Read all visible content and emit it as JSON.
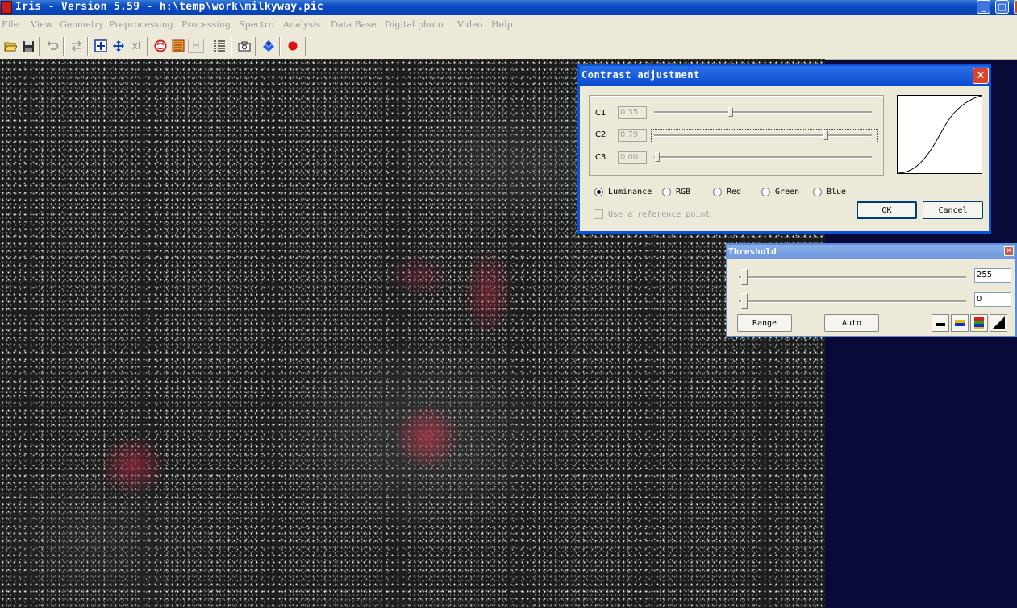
{
  "window": {
    "title": "Iris - Version 5.59 - h:\\temp\\work\\milkyway.pic"
  },
  "menu": [
    "File",
    "View",
    "Geometry",
    "Preprocessing",
    "Processing",
    "Spectro",
    "Analysis",
    "Data Base",
    "Digital photo",
    "Video",
    "Help"
  ],
  "toolbar": {
    "icons": [
      "open-folder-icon",
      "save-icon",
      "undo-icon",
      "swap-icon",
      "zoom-in-icon",
      "move-icon",
      "xl-icon",
      "red-circle-icon",
      "palette-icon",
      "h-icon",
      "list-icon",
      "camera-icon",
      "blue-diamond-icon",
      "record-icon"
    ],
    "xl_label": "xl",
    "h_label": "H"
  },
  "image": {
    "watermark": "航天天文出版社 ... www.astronomy.com.cn"
  },
  "contrast_dialog": {
    "title": "Contrast adjustment",
    "params": [
      {
        "label": "C1",
        "value": "0.35",
        "level": 0.35
      },
      {
        "label": "C2",
        "value": "0.79",
        "level": 0.79
      },
      {
        "label": "C3",
        "value": "0.00",
        "level": 0.0
      }
    ],
    "channels": [
      "Luminance",
      "RGB",
      "Red",
      "Green",
      "Blue"
    ],
    "selected_channel": "Luminance",
    "reference_point_label": "Use a reference point",
    "ok_label": "OK",
    "cancel_label": "Cancel"
  },
  "threshold_dialog": {
    "title": "Threshold",
    "high_value": "255",
    "low_value": "0",
    "range_label": "Range",
    "auto_label": "Auto"
  },
  "colors": {
    "titlebar": "#0a4bc4",
    "background": "#0a0a38",
    "face": "#ece9d8",
    "nebula": "#a02f46"
  }
}
